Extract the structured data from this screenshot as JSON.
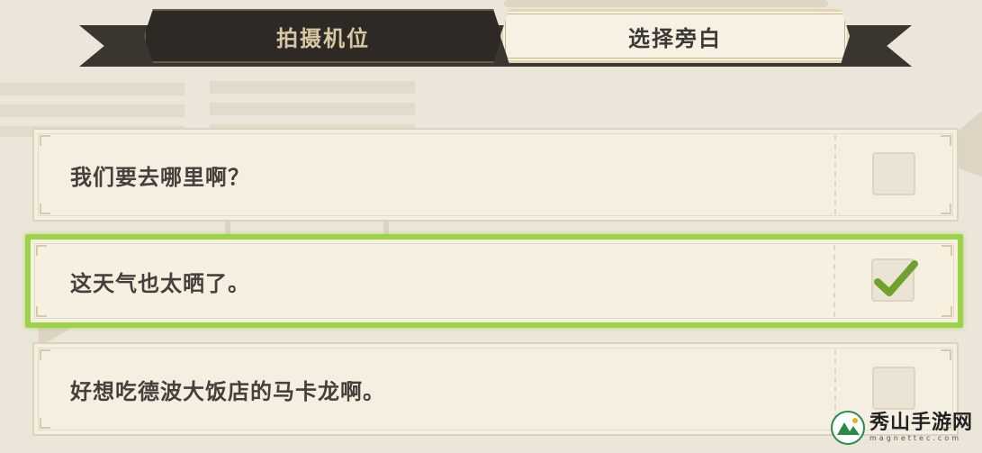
{
  "tabs": [
    {
      "label": "拍摄机位",
      "active": false
    },
    {
      "label": "选择旁白",
      "active": true
    }
  ],
  "options": [
    {
      "text": "我们要去哪里啊？",
      "checked": false
    },
    {
      "text": "这天气也太晒了。",
      "checked": true
    },
    {
      "text": "好想吃德波大饭店的马卡龙啊。",
      "checked": false
    }
  ],
  "watermark": {
    "title": "秀山手游网",
    "subtitle": "magnettec.com"
  },
  "colors": {
    "selected_border": "#9cd14a",
    "check_mark": "#6fa22d",
    "tab_dark": "#2e2925",
    "card_bg": "#f5efe2"
  },
  "icons": {
    "check": "check-icon"
  }
}
